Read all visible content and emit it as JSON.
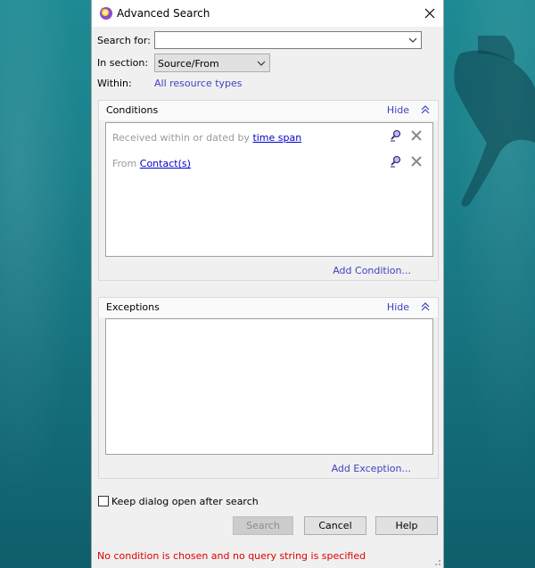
{
  "dialog": {
    "title": "Advanced Search",
    "close_icon": "close-icon",
    "app_icon": "search-wizard-icon"
  },
  "search_for": {
    "label": "Search for:",
    "value": "",
    "placeholder": ""
  },
  "in_section": {
    "label": "In section:",
    "selected": "Source/From"
  },
  "within": {
    "label": "Within:",
    "link": "All resource types"
  },
  "conditions": {
    "title": "Conditions",
    "hide_label": "Hide",
    "add_label": "Add Condition...",
    "items": [
      {
        "prefix": "Received within or dated by",
        "link": "time span"
      },
      {
        "prefix": "From",
        "link": "Contact(s)"
      }
    ]
  },
  "exceptions": {
    "title": "Exceptions",
    "hide_label": "Hide",
    "add_label": "Add Exception..."
  },
  "keep_open": {
    "label": "Keep dialog open after search",
    "checked": false
  },
  "buttons": {
    "search": "Search",
    "cancel": "Cancel",
    "help": "Help"
  },
  "status_message": "No condition is chosen and no query string is specified",
  "colors": {
    "link": "#3f3fc4",
    "error": "#e00000"
  }
}
